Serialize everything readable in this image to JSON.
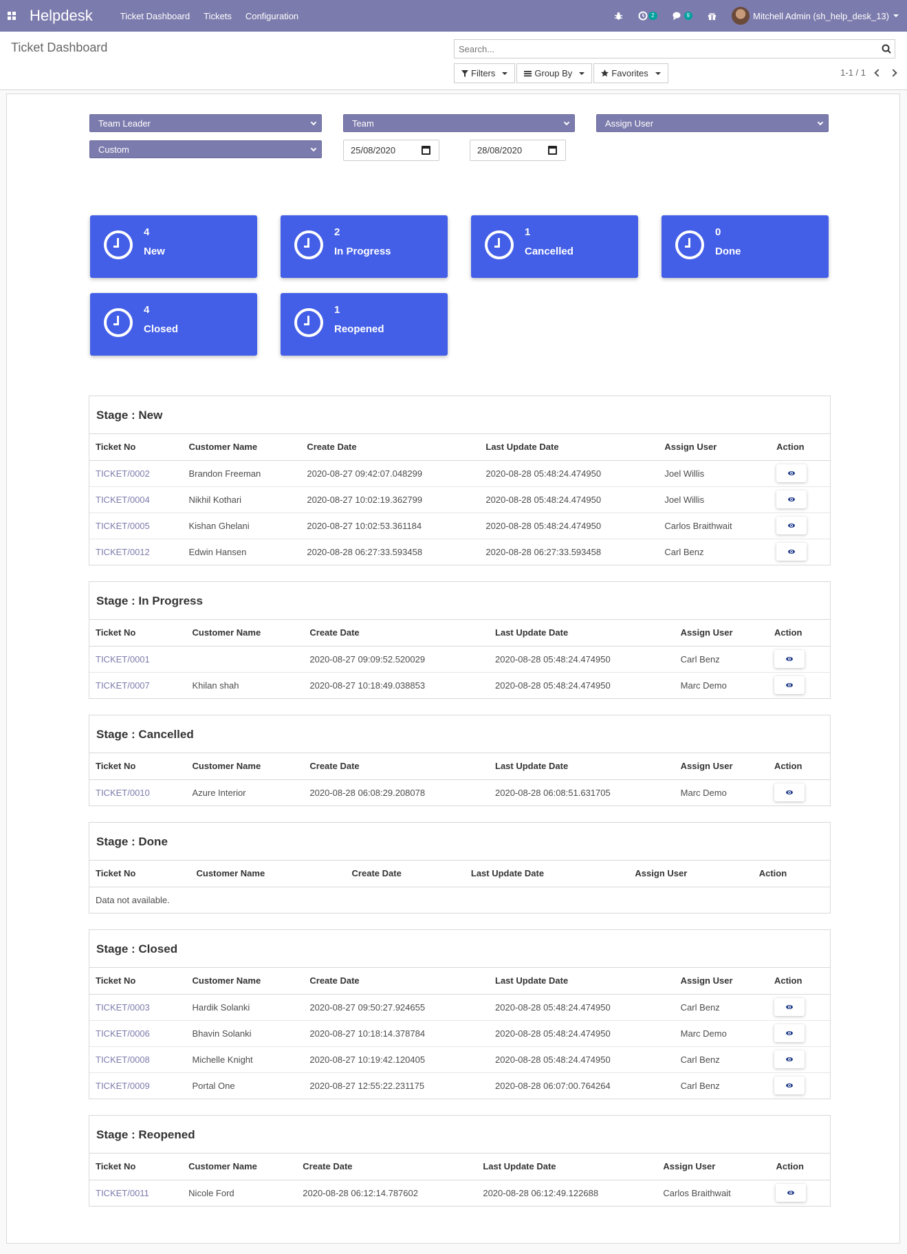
{
  "navbar": {
    "brand": "Helpdesk",
    "menu": [
      "Ticket Dashboard",
      "Tickets",
      "Configuration"
    ],
    "activity_count": "2",
    "message_count": "9",
    "user": "Mitchell Admin (sh_help_desk_13)"
  },
  "control_panel": {
    "title": "Ticket Dashboard",
    "search_placeholder": "Search...",
    "filters_label": "Filters",
    "groupby_label": "Group By",
    "favorites_label": "Favorites",
    "pager": "1-1 / 1"
  },
  "filters": {
    "team_leader": "Team Leader",
    "team": "Team",
    "assign_user": "Assign User",
    "period": "Custom",
    "start_date": "25/08/2020",
    "end_date": "28/08/2020"
  },
  "stats": [
    {
      "count": "4",
      "label": "New"
    },
    {
      "count": "2",
      "label": "In Progress"
    },
    {
      "count": "1",
      "label": "Cancelled"
    },
    {
      "count": "0",
      "label": "Done"
    },
    {
      "count": "4",
      "label": "Closed"
    },
    {
      "count": "1",
      "label": "Reopened"
    }
  ],
  "columns": [
    "Ticket No",
    "Customer Name",
    "Create Date",
    "Last Update Date",
    "Assign User",
    "Action"
  ],
  "empty_text": "Data not available.",
  "stages": [
    {
      "title": "Stage : New",
      "rows": [
        [
          "TICKET/0002",
          "Brandon Freeman",
          "2020-08-27 09:42:07.048299",
          "2020-08-28 05:48:24.474950",
          "Joel Willis"
        ],
        [
          "TICKET/0004",
          "Nikhil Kothari",
          "2020-08-27 10:02:19.362799",
          "2020-08-28 05:48:24.474950",
          "Joel Willis"
        ],
        [
          "TICKET/0005",
          "Kishan Ghelani",
          "2020-08-27 10:02:53.361184",
          "2020-08-28 05:48:24.474950",
          "Carlos Braithwait"
        ],
        [
          "TICKET/0012",
          "Edwin Hansen",
          "2020-08-28 06:27:33.593458",
          "2020-08-28 06:27:33.593458",
          "Carl Benz"
        ]
      ]
    },
    {
      "title": "Stage : In Progress",
      "rows": [
        [
          "TICKET/0001",
          "",
          "2020-08-27 09:09:52.520029",
          "2020-08-28 05:48:24.474950",
          "Carl Benz"
        ],
        [
          "TICKET/0007",
          "Khilan shah",
          "2020-08-27 10:18:49.038853",
          "2020-08-28 05:48:24.474950",
          "Marc Demo"
        ]
      ]
    },
    {
      "title": "Stage : Cancelled",
      "rows": [
        [
          "TICKET/0010",
          "Azure Interior",
          "2020-08-28 06:08:29.208078",
          "2020-08-28 06:08:51.631705",
          "Marc Demo"
        ]
      ]
    },
    {
      "title": "Stage : Done",
      "rows": []
    },
    {
      "title": "Stage : Closed",
      "rows": [
        [
          "TICKET/0003",
          "Hardik Solanki",
          "2020-08-27 09:50:27.924655",
          "2020-08-28 05:48:24.474950",
          "Carl Benz"
        ],
        [
          "TICKET/0006",
          "Bhavin Solanki",
          "2020-08-27 10:18:14.378784",
          "2020-08-28 05:48:24.474950",
          "Marc Demo"
        ],
        [
          "TICKET/0008",
          "Michelle Knight",
          "2020-08-27 10:19:42.120405",
          "2020-08-28 05:48:24.474950",
          "Carl Benz"
        ],
        [
          "TICKET/0009",
          "Portal One",
          "2020-08-27 12:55:22.231175",
          "2020-08-28 06:07:00.764264",
          "Carl Benz"
        ]
      ]
    },
    {
      "title": "Stage : Reopened",
      "rows": [
        [
          "TICKET/0011",
          "Nicole Ford",
          "2020-08-28 06:12:14.787602",
          "2020-08-28 06:12:49.122688",
          "Carlos Braithwait"
        ]
      ]
    }
  ],
  "colors": {
    "brand": "#7c7bad",
    "card": "#435ee7",
    "badge": "#00a09d",
    "link": "#7c7bad"
  }
}
